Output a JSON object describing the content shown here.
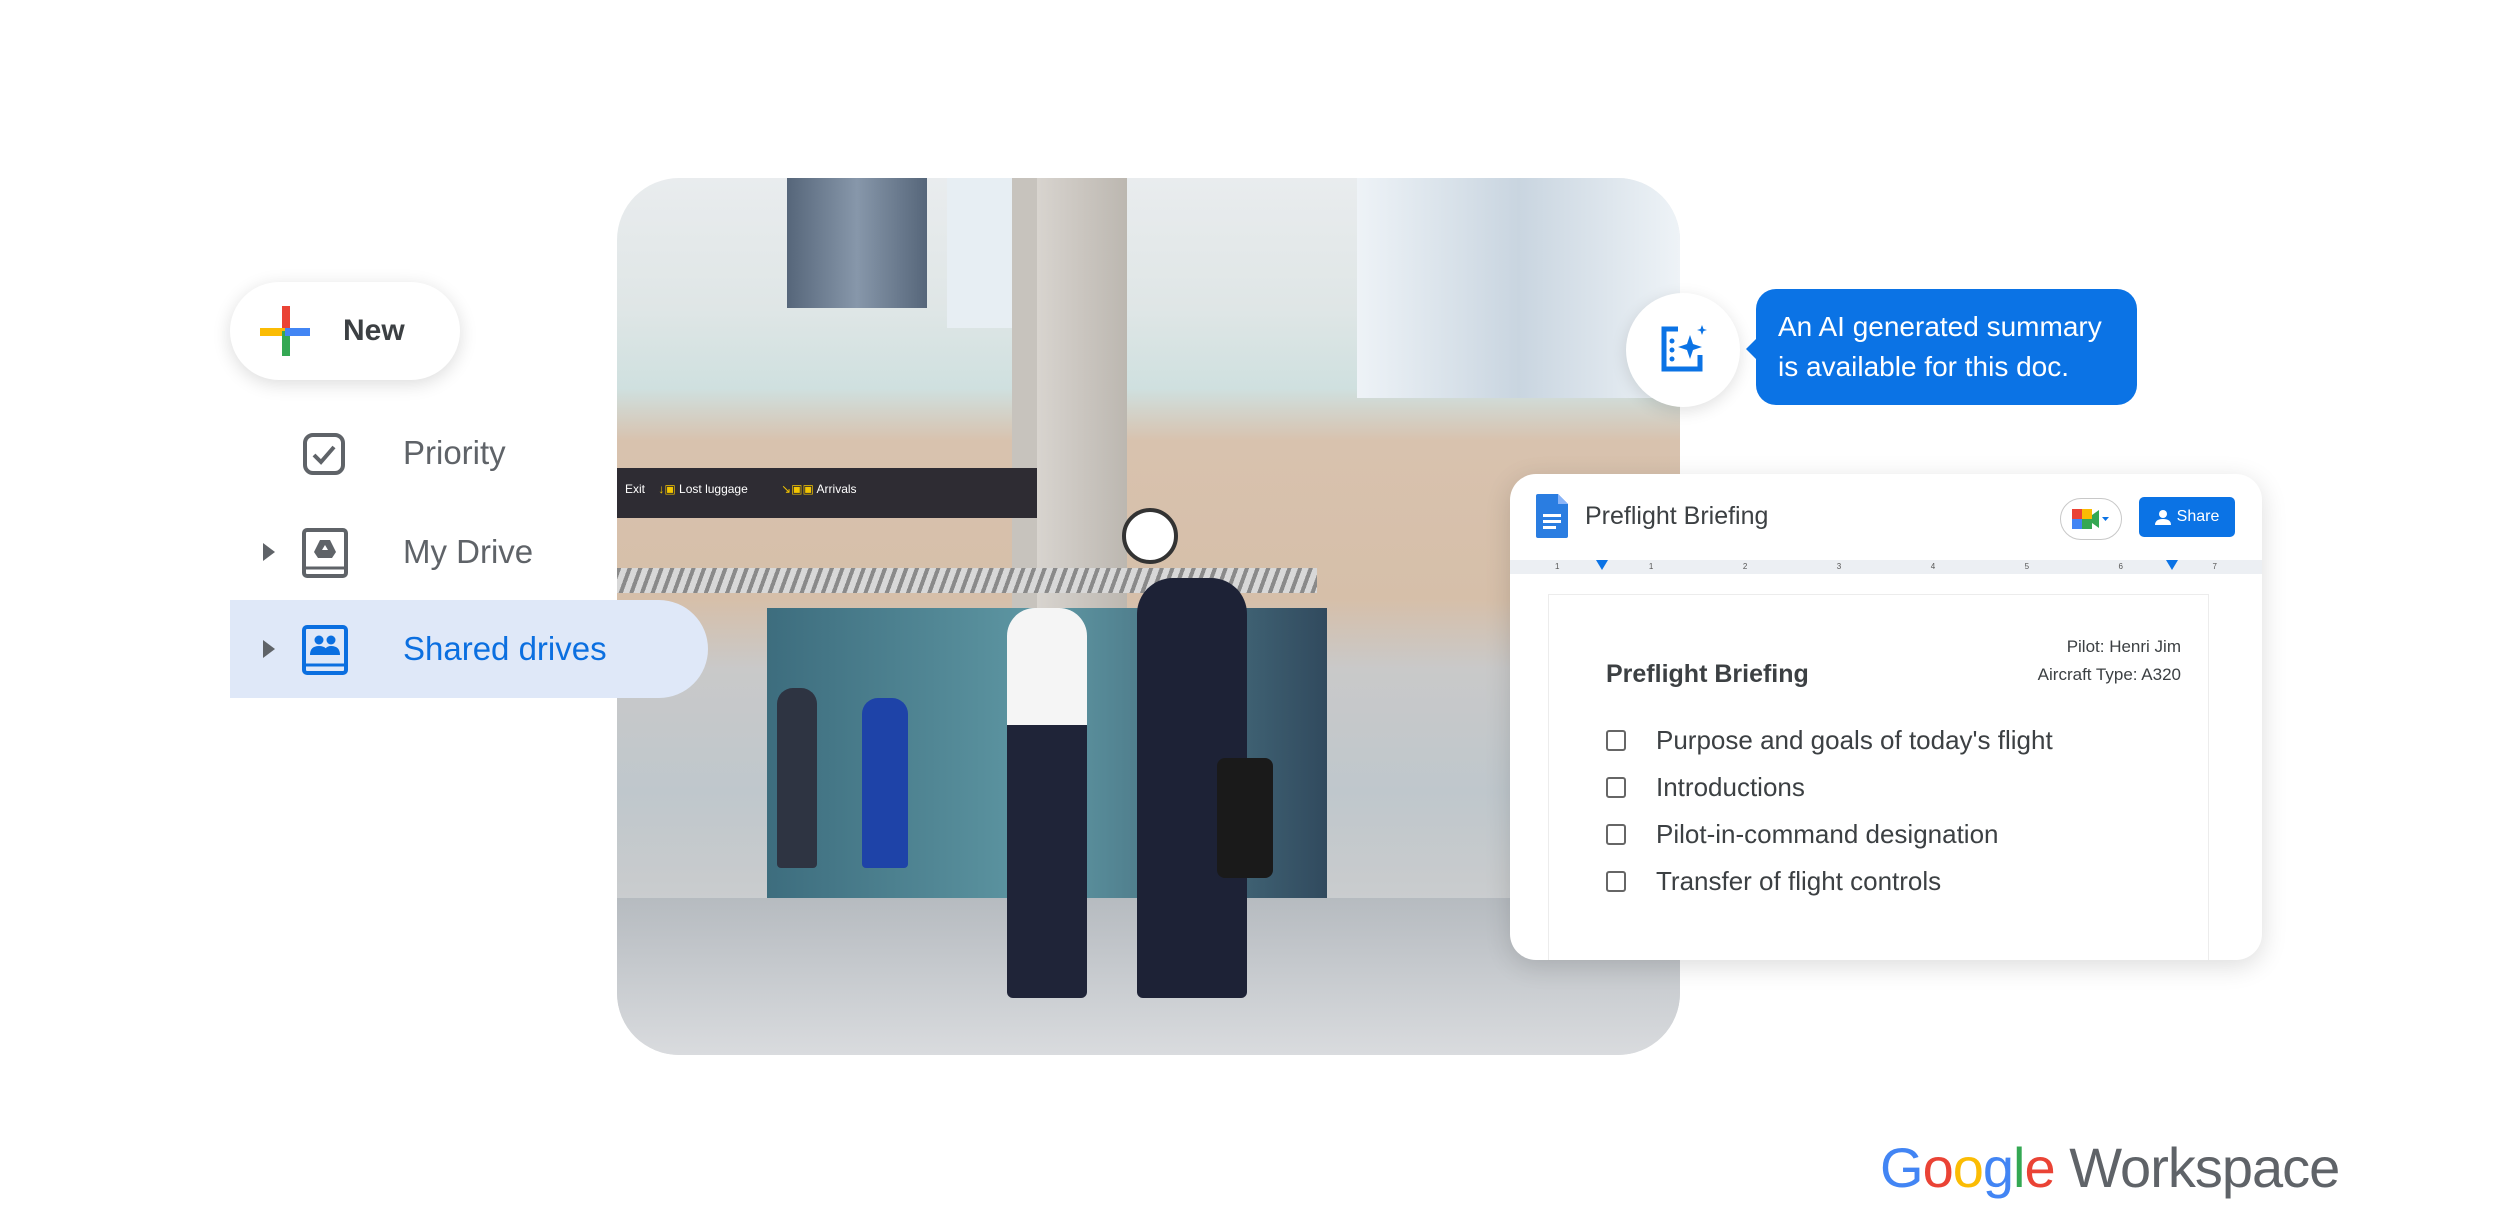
{
  "sidebar": {
    "new_label": "New",
    "items": [
      {
        "label": "Priority",
        "icon": "priority-check-icon",
        "expandable": false,
        "selected": false
      },
      {
        "label": "My Drive",
        "icon": "my-drive-icon",
        "expandable": true,
        "selected": false
      },
      {
        "label": "Shared drives",
        "icon": "shared-drives-icon",
        "expandable": true,
        "selected": true
      }
    ]
  },
  "ai_tooltip": {
    "icon": "ai-summary-sparkle-icon",
    "text": "An AI generated summary is available for this doc."
  },
  "doc": {
    "title": "Preflight Briefing",
    "share_label": "Share",
    "ruler_marks": [
      "1",
      "1",
      "2",
      "3",
      "4",
      "5",
      "6",
      "7"
    ],
    "heading": "Preflight Briefing",
    "pilot": "Pilot: Henri Jim",
    "aircraft": "Aircraft Type: A320",
    "checklist": [
      "Purpose and goals of today's flight",
      "Introductions",
      "Pilot-in-command designation",
      "Transfer of flight controls"
    ]
  },
  "photo": {
    "sign_exit": "Exit",
    "sign_lost": "Lost luggage",
    "sign_arrivals": "Arrivals"
  },
  "logo": {
    "google": "Google",
    "workspace": "Workspace"
  },
  "colors": {
    "accent": "#0b73e5",
    "selected_bg": "#dfe8f8",
    "text": "#3c4043"
  }
}
